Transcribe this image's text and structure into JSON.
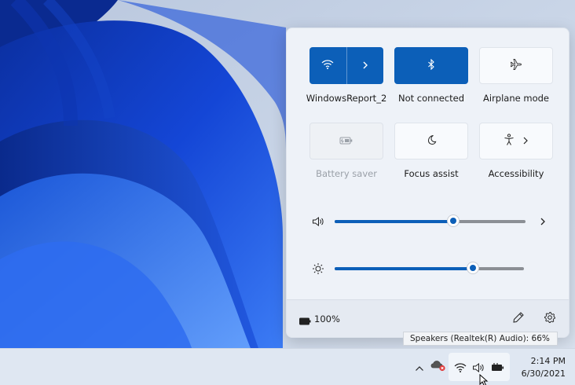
{
  "quick_settings": {
    "tiles": [
      {
        "id": "wifi",
        "label": "WindowsReport_2",
        "state": "on",
        "icon": "wifi-icon",
        "has_chevron": true
      },
      {
        "id": "bluetooth",
        "label": "Not connected",
        "state": "on",
        "icon": "bluetooth-icon"
      },
      {
        "id": "airplane",
        "label": "Airplane mode",
        "state": "off",
        "icon": "airplane-icon"
      },
      {
        "id": "battery_saver",
        "label": "Battery saver",
        "state": "disabled",
        "icon": "battery-saver-icon"
      },
      {
        "id": "focus_assist",
        "label": "Focus assist",
        "state": "off",
        "icon": "moon-icon"
      },
      {
        "id": "accessibility",
        "label": "Accessibility",
        "state": "off",
        "icon": "accessibility-icon",
        "has_chevron": true
      }
    ],
    "volume": {
      "level_percent": 62,
      "icon": "speaker-icon"
    },
    "brightness": {
      "level_percent": 73,
      "icon": "sun-icon"
    },
    "footer": {
      "battery_text": "100%",
      "battery_icon": "battery-icon",
      "edit_icon": "pencil-icon",
      "settings_icon": "gear-icon"
    }
  },
  "tooltip": {
    "text": "Speakers (Realtek(R) Audio): 66%"
  },
  "taskbar": {
    "clock_time": "2:14 PM",
    "clock_date": "6/30/2021",
    "tray_icons": [
      "chevron-up-icon",
      "cloud-error-icon",
      "wifi-icon",
      "speaker-icon",
      "battery-charging-icon"
    ]
  },
  "colors": {
    "accent": "#0c5fb8",
    "panel_bg": "#eef2f8",
    "taskbar_bg": "#dfe7f2"
  }
}
